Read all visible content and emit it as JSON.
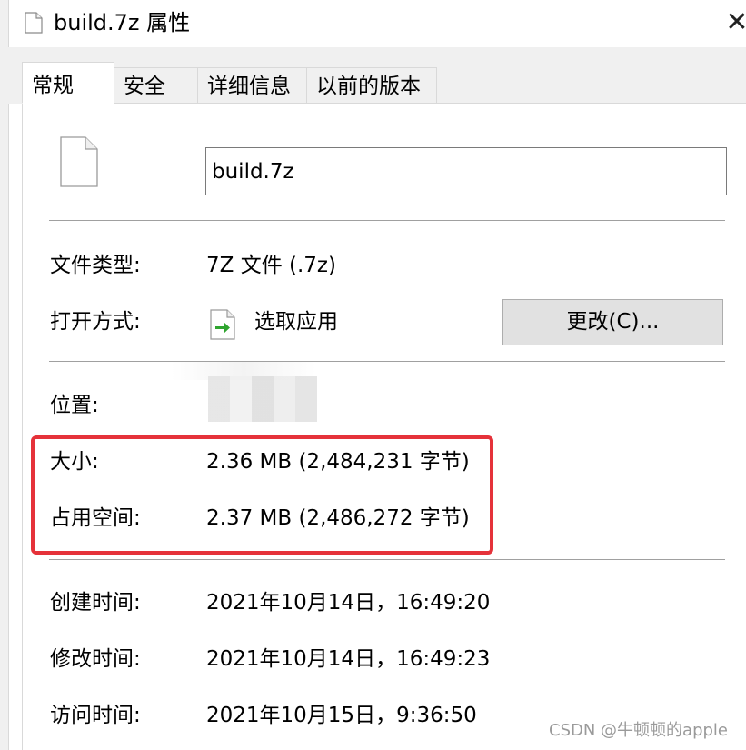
{
  "window": {
    "title": "build.7z 属性",
    "close_glyph": "✕"
  },
  "tabs": [
    {
      "label": "常规",
      "active": true
    },
    {
      "label": "安全",
      "active": false
    },
    {
      "label": "详细信息",
      "active": false
    },
    {
      "label": "以前的版本",
      "active": false
    }
  ],
  "general": {
    "file_name": "build.7z",
    "type_label": "文件类型:",
    "type_value": "7Z 文件 (.7z)",
    "open_with_label": "打开方式:",
    "open_with_value": "选取应用",
    "change_button": "更改(C)...",
    "location_label": "位置:",
    "size_label": "大小:",
    "size_value": "2.36 MB (2,484,231 字节)",
    "disk_size_label": "占用空间:",
    "disk_size_value": "2.37 MB (2,486,272 字节)",
    "created_label": "创建时间:",
    "created_value": "2021年10月14日，16:49:20",
    "modified_label": "修改时间:",
    "modified_value": "2021年10月14日，16:49:23",
    "accessed_label": "访问时间:",
    "accessed_value": "2021年10月15日，9:36:50"
  },
  "colors": {
    "highlight": "#e5323a",
    "tab_bg": "#f0f0f0",
    "button_bg": "#e1e1e1"
  },
  "watermark": "CSDN @牛顿顿的apple"
}
